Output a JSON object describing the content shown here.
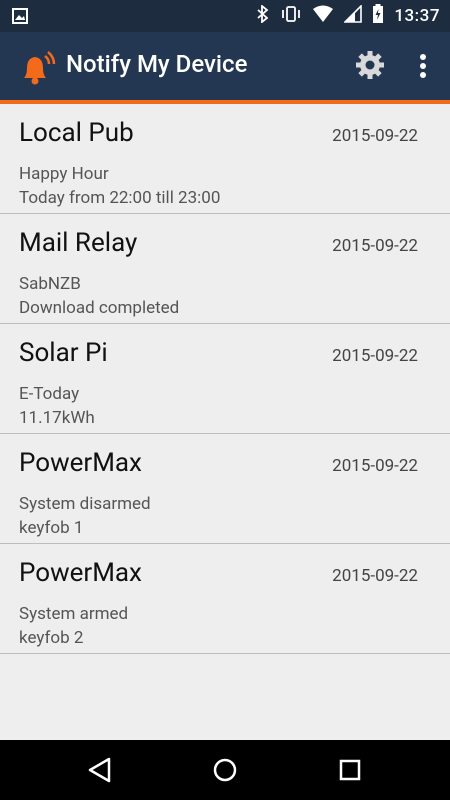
{
  "status_bar": {
    "time": "13:37",
    "left_icon": "image-icon",
    "right_icons": [
      "bluetooth-icon",
      "vibrate-icon",
      "wifi-icon",
      "signal-icon",
      "battery-icon"
    ]
  },
  "app_bar": {
    "title": "Notify My Device",
    "logo": "bell-icon",
    "actions": [
      "settings-icon",
      "overflow-menu-icon"
    ],
    "colors": {
      "bar": "#233752",
      "accent": "#f36a1b"
    }
  },
  "notifications": [
    {
      "title": "Local Pub",
      "date": "2015-09-22",
      "line1": "Happy Hour",
      "line2": "Today from 22:00 till 23:00"
    },
    {
      "title": "Mail Relay",
      "date": "2015-09-22",
      "line1": "SabNZB",
      "line2": "Download completed"
    },
    {
      "title": "Solar Pi",
      "date": "2015-09-22",
      "line1": "E-Today",
      "line2": "11.17kWh"
    },
    {
      "title": "PowerMax",
      "date": "2015-09-22",
      "line1": "System disarmed",
      "line2": "keyfob 1"
    },
    {
      "title": "PowerMax",
      "date": "2015-09-22",
      "line1": "System armed",
      "line2": "keyfob 2"
    }
  ],
  "nav_bar": {
    "buttons": [
      "back-icon",
      "home-icon",
      "recents-icon"
    ]
  }
}
